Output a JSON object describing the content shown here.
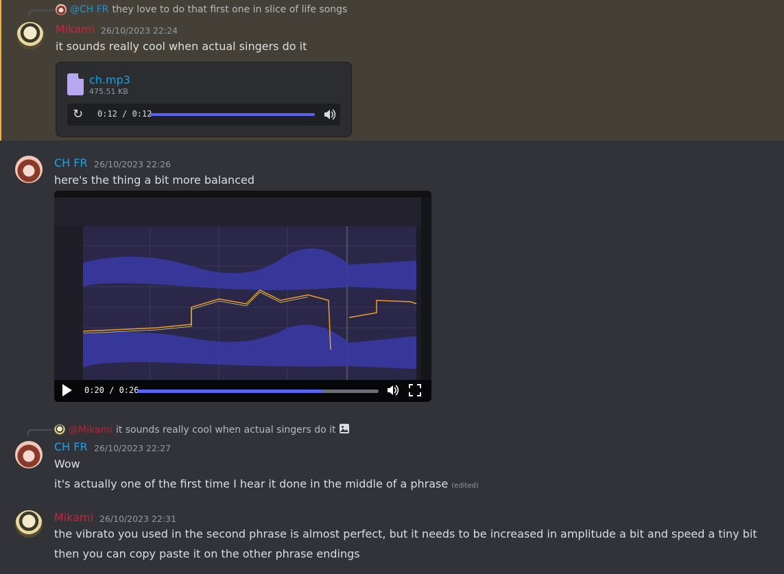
{
  "messages": [
    {
      "reply": {
        "mention": "@CH FR",
        "text": "they love to do that first one in slice of life songs"
      },
      "author": "Mikami",
      "timestamp": "26/10/2023 22:24",
      "lines": [
        "it sounds really cool when actual singers do it"
      ],
      "attachment": {
        "file_name": "ch.mp3",
        "file_size": "475.51 KB",
        "time": "0:12 / 0:12",
        "progress": 1.0
      }
    },
    {
      "author": "CH FR",
      "timestamp": "26/10/2023 22:26",
      "lines": [
        "here's the thing a bit more balanced"
      ],
      "video": {
        "time": "0:20 / 0:26",
        "progress": 0.77
      }
    },
    {
      "reply": {
        "mention": "@Mikami",
        "text": "it sounds really cool when actual singers do it"
      },
      "author": "CH FR",
      "timestamp": "26/10/2023 22:27",
      "lines": [
        "Wow",
        "it's actually one of the first time I hear it done in the middle of a phrase"
      ],
      "edited": "(edited)"
    },
    {
      "author": "Mikami",
      "timestamp": "26/10/2023 22:31",
      "lines": [
        "the vibrato you used in the second phrase is almost perfect, but it needs to be increased in amplitude a bit and speed a tiny bit",
        "then you can copy paste it on the other phrase endings"
      ]
    }
  ],
  "colors": {
    "mikami": "#d21f3c",
    "chfr": "#21a1e8",
    "accent": "#5865f2",
    "highlight_bar": "#f0b232"
  },
  "icons": {
    "replay": "replay-icon",
    "volume": "volume-icon",
    "play": "play-icon",
    "fullscreen": "fullscreen-icon",
    "image": "image-icon",
    "audio_file": "audio-file-icon"
  }
}
